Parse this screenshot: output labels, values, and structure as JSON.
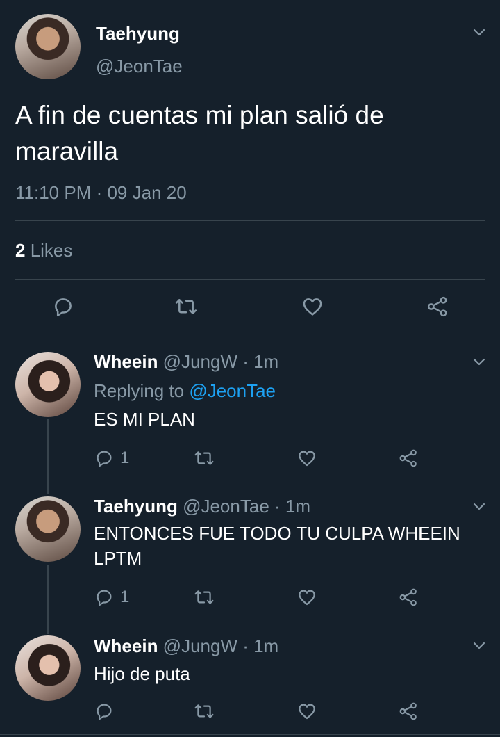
{
  "main_tweet": {
    "author_name": "Taehyung",
    "author_handle": "@JeonTae",
    "text": "A fin de cuentas mi plan salió de maravilla",
    "timestamp": "11:10 PM · 09 Jan 20",
    "likes_count": "2",
    "likes_label": " Likes",
    "actions": [
      "reply-icon",
      "retweet-icon",
      "like-icon",
      "share-icon"
    ]
  },
  "replies": [
    {
      "author_name": "Wheein",
      "meta": " @JungW · 1m",
      "replying_prefix": "Replying to ",
      "replying_to": "@JeonTae",
      "text": "ES MI PLAN",
      "reply_count": "1"
    },
    {
      "author_name": "Taehyung",
      "meta": " @JeonTae · 1m",
      "text": "ENTONCES FUE TODO TU CULPA WHEEIN LPTM",
      "reply_count": "1"
    },
    {
      "author_name": "Wheein",
      "meta": " @JungW · 1m",
      "text": "Hijo de puta",
      "reply_count": ""
    }
  ],
  "colors": {
    "background": "#15202b",
    "secondary_text": "#8899a6",
    "link": "#1da1f2",
    "divider": "#38444d"
  }
}
